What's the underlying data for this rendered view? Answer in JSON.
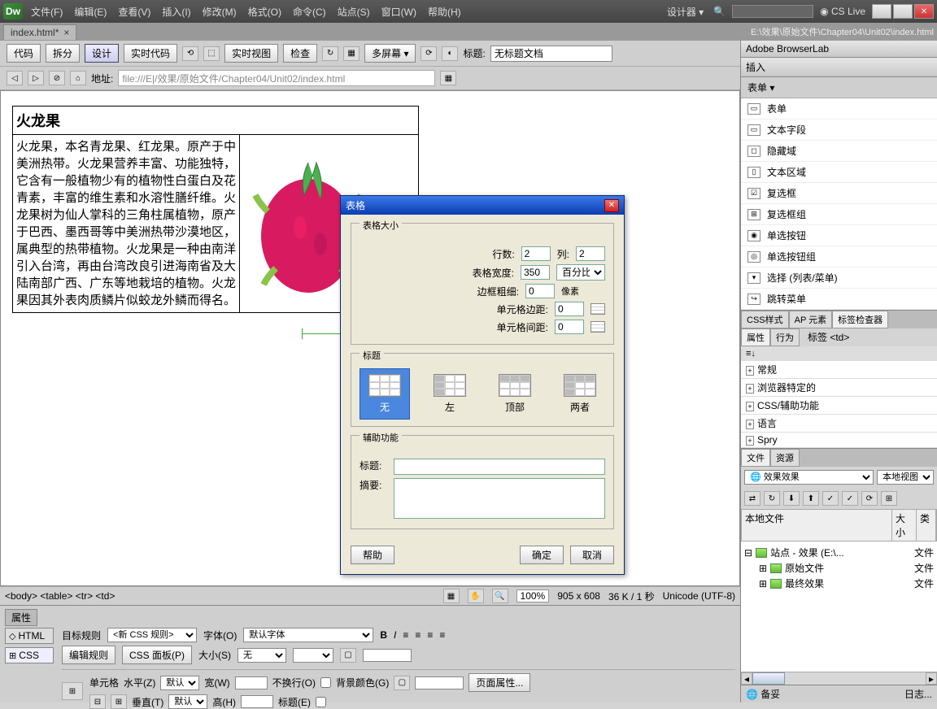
{
  "menu": {
    "items": [
      "文件(F)",
      "编辑(E)",
      "查看(V)",
      "插入(I)",
      "修改(M)",
      "格式(O)",
      "命令(C)",
      "站点(S)",
      "窗口(W)",
      "帮助(H)"
    ],
    "designer": "设计器 ▾",
    "cslive": "CS Live"
  },
  "tab": {
    "filename": "index.html*",
    "path": "E:\\效果\\原始文件\\Chapter04\\Unit02\\index.html"
  },
  "toolbar": {
    "code": "代码",
    "split": "拆分",
    "design": "设计",
    "live_code": "实时代码",
    "live_view": "实时视图",
    "inspect": "检查",
    "multi": "多屏幕",
    "title_label": "标题:",
    "title_value": "无标题文档",
    "addr_label": "地址:",
    "addr_value": "file:///E|/效果/原始文件/Chapter04/Unit02/index.html"
  },
  "doc": {
    "heading": "火龙果",
    "body": "火龙果，本名青龙果、红龙果。原产于中美洲热带。火龙果营养丰富、功能独特，它含有一般植物少有的植物性白蛋白及花青素，丰富的维生素和水溶性膳纤维。火龙果树为仙人掌科的三角柱属植物，原产于巴西、墨西哥等中美洲热带沙漠地区，属典型的热带植物。火龙果是一种由南洋引入台湾，再由台湾改良引进海南省及大陆南部广西、广东等地栽培的植物。火龙果因其外表肉质鳞片似蛟龙外鳞而得名。",
    "ruler": "500"
  },
  "status": {
    "breadcrumb": "<body> <table> <tr> <td>",
    "zoom": "100%",
    "size": "905 x 608",
    "weight": "36 K / 1 秒",
    "enc": "Unicode (UTF-8)"
  },
  "props": {
    "title": "属性",
    "html": "HTML",
    "css": "CSS",
    "target_rule": "目标规则",
    "new_css": "<新 CSS 规则>",
    "edit_rule": "编辑规则",
    "css_panel": "CSS 面板(P)",
    "font": "字体(O)",
    "font_val": "默认字体",
    "size": "大小(S)",
    "size_val": "无",
    "cell": "单元格",
    "horiz": "水平(Z)",
    "horiz_val": "默认",
    "width": "宽(W)",
    "nowrap": "不换行(O)",
    "bgcolor": "背景颜色(G)",
    "vert": "垂直(T)",
    "vert_val": "默认",
    "height": "高(H)",
    "header": "标题(E)",
    "page_props": "页面属性..."
  },
  "right": {
    "browserlab": "Adobe BrowserLab",
    "insert": {
      "title": "插入",
      "category": "表单 ▾",
      "items": [
        "表单",
        "文本字段",
        "隐藏域",
        "文本区域",
        "复选框",
        "复选框组",
        "单选按钮",
        "单选按钮组",
        "选择 (列表/菜单)",
        "跳转菜单"
      ]
    },
    "inspector": {
      "tabs": [
        "CSS样式",
        "AP 元素",
        "标签检查器"
      ],
      "subtabs": [
        "属性",
        "行为"
      ],
      "tag": "标签 <td>",
      "rows": [
        "常规",
        "浏览器特定的",
        "CSS/辅助功能",
        "语言",
        "Spry"
      ]
    },
    "files": {
      "tabs": [
        "文件",
        "资源"
      ],
      "site": "效果",
      "view": "本地视图",
      "cols": [
        "本地文件",
        "大小",
        "类"
      ],
      "root": "站点 - 效果 (E:\\...",
      "folders": [
        "原始文件",
        "最终效果"
      ],
      "type": "文件",
      "ready": "备妥",
      "log": "日志..."
    }
  },
  "dialog": {
    "title": "表格",
    "size_group": "表格大小",
    "rows_label": "行数:",
    "rows_val": "2",
    "cols_label": "列:",
    "cols_val": "2",
    "width_label": "表格宽度:",
    "width_val": "350",
    "width_unit": "百分比",
    "border_label": "边框粗细:",
    "border_val": "0",
    "border_unit": "像素",
    "padding_label": "单元格边距:",
    "padding_val": "0",
    "spacing_label": "单元格间距:",
    "spacing_val": "0",
    "header_group": "标题",
    "header_opts": [
      "无",
      "左",
      "顶部",
      "两者"
    ],
    "aux_group": "辅助功能",
    "caption_label": "标题:",
    "summary_label": "摘要:",
    "help": "帮助",
    "ok": "确定",
    "cancel": "取消"
  }
}
